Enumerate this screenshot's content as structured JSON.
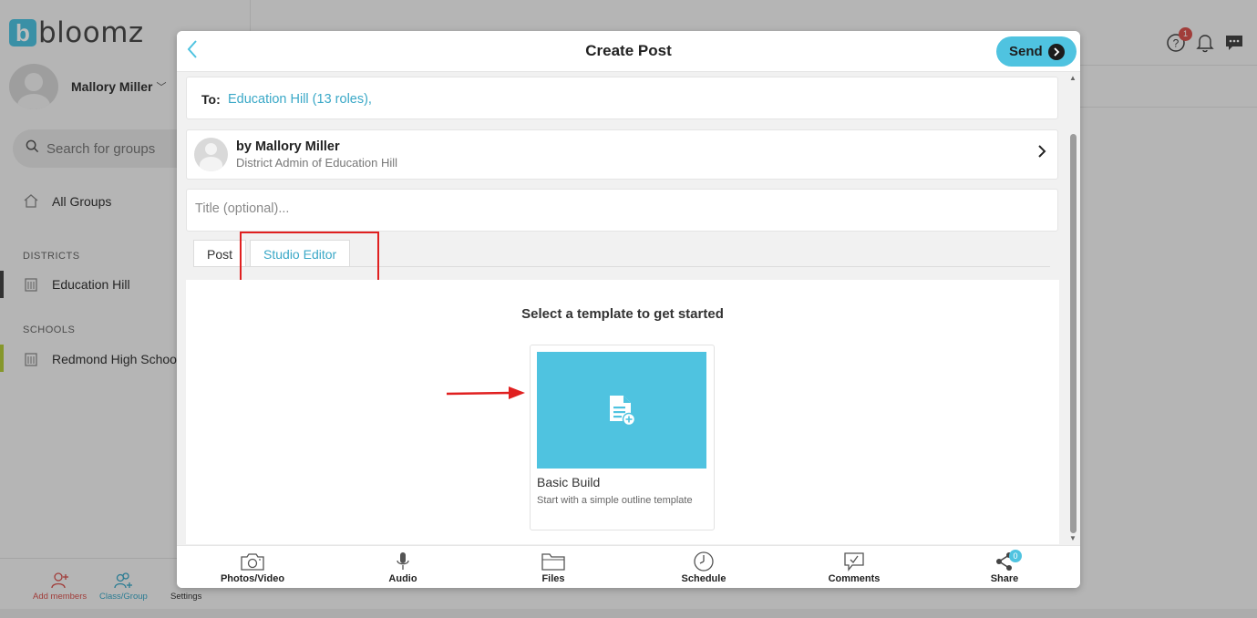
{
  "app": {
    "brand_letter": "b",
    "brand_name": "bloomz",
    "user_name": "Mallory Miller",
    "search_placeholder": "Search for groups",
    "all_groups": "All Groups",
    "districts_label": "DISTRICTS",
    "district_item": "Education Hill",
    "schools_label": "SCHOOLS",
    "school_item": "Redmond High Schoo",
    "bottom": {
      "add_members": "Add members",
      "class_group": "Class/Group",
      "settings": "Settings"
    },
    "notification_count": "1",
    "colors": {
      "accent": "#4fc3e0",
      "danger": "#d9534f"
    }
  },
  "modal": {
    "title": "Create Post",
    "send_label": "Send",
    "to_label": "To:",
    "to_value": "Education Hill (13 roles),",
    "author_name": "by Mallory Miller",
    "author_role": "District Admin of Education Hill",
    "title_placeholder": "Title (optional)...",
    "tabs": [
      {
        "label": "Post",
        "active": false
      },
      {
        "label": "Studio Editor",
        "active": true
      }
    ],
    "studio": {
      "heading": "Select a template to get started",
      "templates": [
        {
          "name": "Basic Build",
          "description": "Start with a simple outline template",
          "icon": "document-add-icon"
        }
      ]
    },
    "toolbar": [
      {
        "label": "Photos/Video",
        "icon": "camera-icon"
      },
      {
        "label": "Audio",
        "icon": "microphone-icon"
      },
      {
        "label": "Files",
        "icon": "folder-icon"
      },
      {
        "label": "Schedule",
        "icon": "clock-icon"
      },
      {
        "label": "Comments",
        "icon": "comment-icon"
      },
      {
        "label": "Share",
        "icon": "share-icon",
        "badge": "0"
      }
    ]
  }
}
